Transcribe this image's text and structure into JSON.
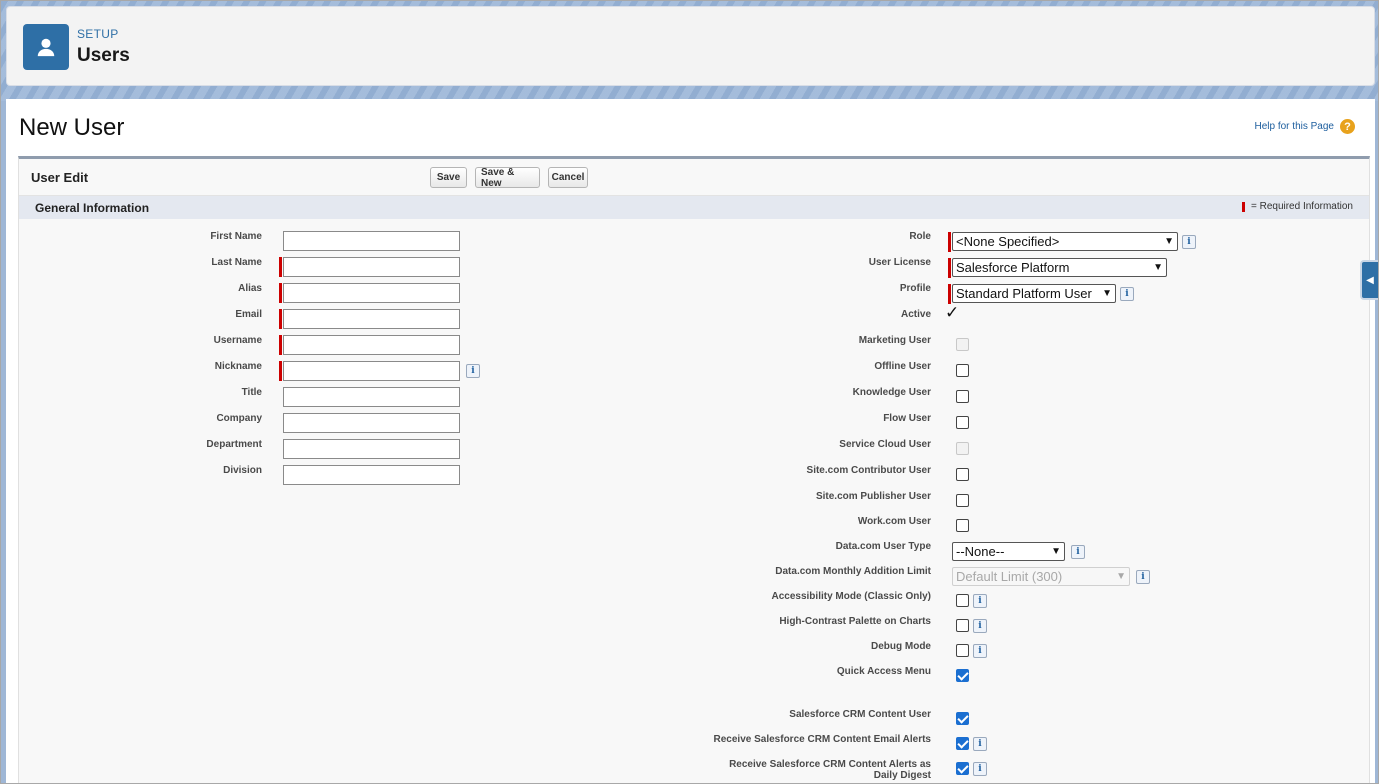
{
  "header": {
    "crumb": "SETUP",
    "title": "Users",
    "icon": "user-icon"
  },
  "page": {
    "title": "New User",
    "help_link": "Help for this Page",
    "help_icon": "?"
  },
  "block": {
    "title": "User Edit",
    "buttons": {
      "save": "Save",
      "save_new": "Save & New",
      "cancel": "Cancel"
    }
  },
  "section": {
    "title": "General Information",
    "required_legend": "= Required Information"
  },
  "left_fields": [
    {
      "label": "First Name",
      "value": "",
      "required": false
    },
    {
      "label": "Last Name",
      "value": "",
      "required": true
    },
    {
      "label": "Alias",
      "value": "",
      "required": true
    },
    {
      "label": "Email",
      "value": "",
      "required": true
    },
    {
      "label": "Username",
      "value": "",
      "required": true
    },
    {
      "label": "Nickname",
      "value": "",
      "required": true
    },
    {
      "label": "Title",
      "value": "",
      "required": false
    },
    {
      "label": "Company",
      "value": "",
      "required": false
    },
    {
      "label": "Department",
      "value": "",
      "required": false
    },
    {
      "label": "Division",
      "value": "",
      "required": false
    }
  ],
  "right_fields": {
    "role": {
      "label": "Role",
      "value": "<None Specified>"
    },
    "user_license": {
      "label": "User License",
      "value": "Salesforce Platform"
    },
    "profile": {
      "label": "Profile",
      "value": "Standard Platform User"
    },
    "active": {
      "label": "Active",
      "mark": "✓"
    },
    "marketing_user": {
      "label": "Marketing User"
    },
    "offline_user": {
      "label": "Offline User"
    },
    "knowledge_user": {
      "label": "Knowledge User"
    },
    "flow_user": {
      "label": "Flow User"
    },
    "service_cloud_user": {
      "label": "Service Cloud User"
    },
    "site_contributor": {
      "label": "Site.com Contributor User"
    },
    "site_publisher": {
      "label": "Site.com Publisher User"
    },
    "workcom_user": {
      "label": "Work.com User"
    },
    "datacom_user_type": {
      "label": "Data.com User Type",
      "value": "--None--"
    },
    "datacom_limit": {
      "label": "Data.com Monthly Addition Limit",
      "value": "Default Limit (300)"
    },
    "accessibility_mode": {
      "label": "Accessibility Mode (Classic Only)"
    },
    "high_contrast": {
      "label": "High-Contrast Palette on Charts"
    },
    "debug_mode": {
      "label": "Debug Mode"
    },
    "quick_access": {
      "label": "Quick Access Menu",
      "checked": true
    },
    "crm_content_user": {
      "label": "Salesforce CRM Content User",
      "checked": true
    },
    "crm_email_alerts": {
      "label": "Receive Salesforce CRM Content Email Alerts",
      "checked": true
    },
    "crm_daily_digest": {
      "label_line1": "Receive Salesforce CRM Content Alerts as",
      "label_line2": "Daily Digest",
      "checked": true
    }
  },
  "info_glyph": "i",
  "side_tab_glyph": "◀",
  "colors": {
    "brand": "#2e6fa6",
    "required": "#cc0000",
    "checkbox_checked": "#1b6fd1"
  }
}
